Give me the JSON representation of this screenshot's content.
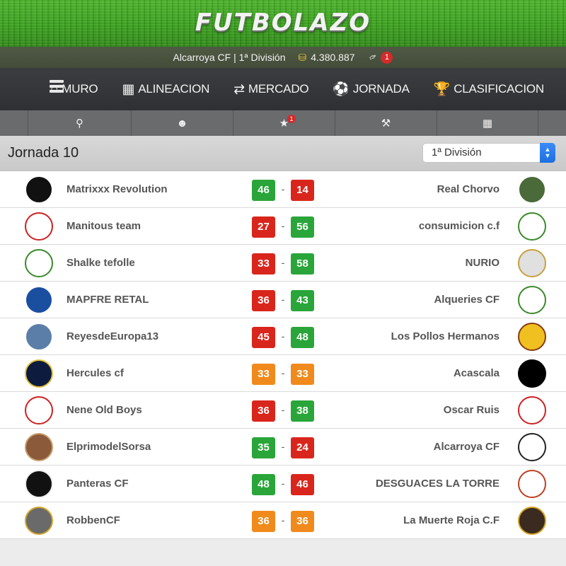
{
  "header": {
    "logo_text": "FUTBOLAZO",
    "team_info": "Alcarroya CF | 1ª División",
    "money": "4.380.887",
    "notifications": "1"
  },
  "nav": {
    "items": [
      {
        "icon": "home-icon",
        "label": "MURO"
      },
      {
        "icon": "lineup-icon",
        "label": "ALINEACION"
      },
      {
        "icon": "transfer-icon",
        "label": "MERCADO"
      },
      {
        "icon": "ball-icon",
        "label": "JORNADA"
      },
      {
        "icon": "trophy-icon",
        "label": "CLASIFICACION"
      }
    ]
  },
  "subnav": {
    "items": [
      "search-icon",
      "users-icon",
      "star-icon",
      "gavel-icon",
      "calendar-icon"
    ],
    "star_badge": "1"
  },
  "round": {
    "title": "Jornada 10",
    "division_selected": "1ª División"
  },
  "colors": {
    "win": "#2aa53a",
    "loss": "#d9261c",
    "draw": "#f08a1c"
  },
  "matches": [
    {
      "home": "Matrixxx Revolution",
      "home_score": "46",
      "away_score": "14",
      "away": "Real Chorvo",
      "home_result": "win",
      "away_result": "loss"
    },
    {
      "home": "Manitous team",
      "home_score": "27",
      "away_score": "56",
      "away": "consumicion c.f",
      "home_result": "loss",
      "away_result": "win"
    },
    {
      "home": "Shalke tefolle",
      "home_score": "33",
      "away_score": "58",
      "away": "NURIO",
      "home_result": "loss",
      "away_result": "win"
    },
    {
      "home": "MAPFRE RETAL",
      "home_score": "36",
      "away_score": "43",
      "away": "Alqueries CF",
      "home_result": "loss",
      "away_result": "win"
    },
    {
      "home": "ReyesdeEuropa13",
      "home_score": "45",
      "away_score": "48",
      "away": "Los Pollos Hermanos",
      "home_result": "loss",
      "away_result": "win"
    },
    {
      "home": "Hercules cf",
      "home_score": "33",
      "away_score": "33",
      "away": "Acascala",
      "home_result": "draw",
      "away_result": "draw"
    },
    {
      "home": "Nene Old Boys",
      "home_score": "36",
      "away_score": "38",
      "away": "Oscar Ruis",
      "home_result": "loss",
      "away_result": "win"
    },
    {
      "home": "ElprimodelSorsa",
      "home_score": "35",
      "away_score": "24",
      "away": "Alcarroya CF",
      "home_result": "win",
      "away_result": "loss"
    },
    {
      "home": "Panteras CF",
      "home_score": "48",
      "away_score": "46",
      "away": "DESGUACES LA TORRE",
      "home_result": "win",
      "away_result": "loss"
    },
    {
      "home": "RobbenCF",
      "home_score": "36",
      "away_score": "36",
      "away": "La Muerte Roja C.F",
      "home_result": "draw",
      "away_result": "draw"
    }
  ]
}
